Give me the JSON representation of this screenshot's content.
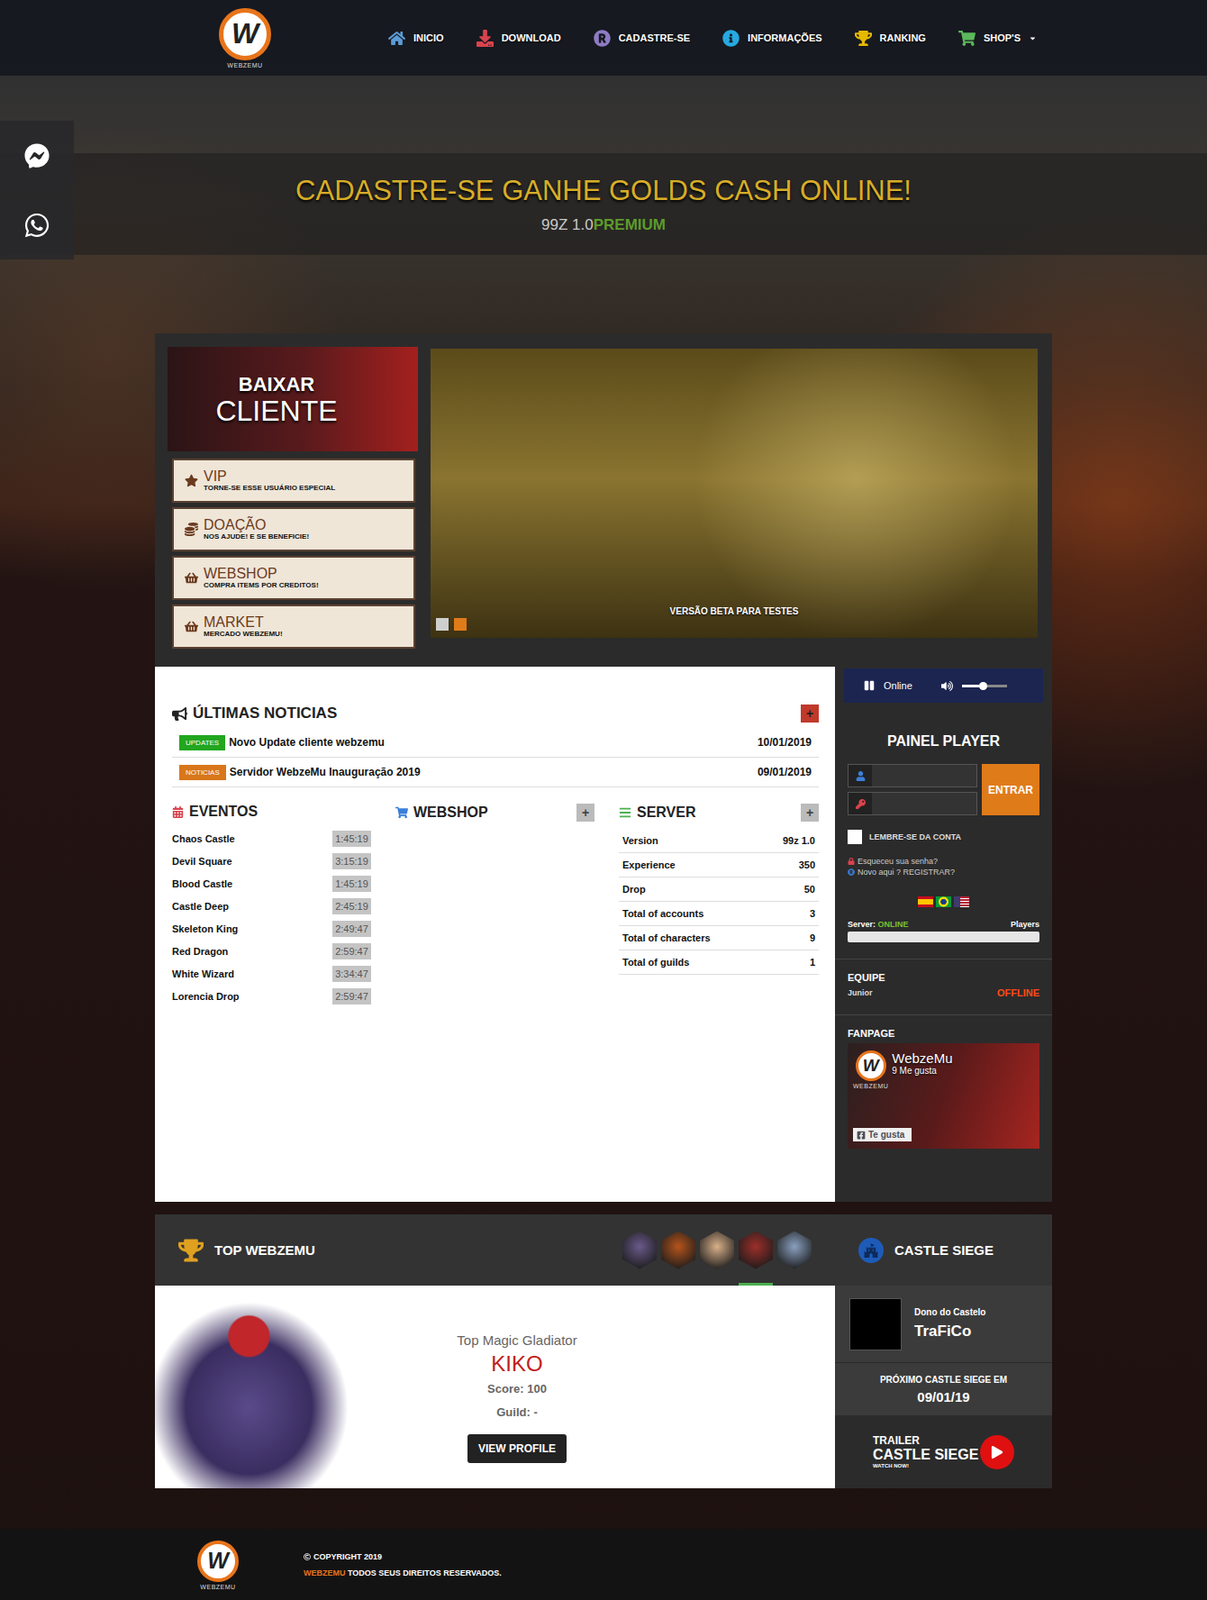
{
  "header": {
    "logo_letter": "W",
    "logo_caption": "WEBZEMU",
    "nav": [
      {
        "label": "INICIO",
        "dropdown": false
      },
      {
        "label": "DOWNLOAD",
        "dropdown": false
      },
      {
        "label": "CADASTRE-SE",
        "dropdown": false
      },
      {
        "label": "INFORMAÇÕES",
        "dropdown": false
      },
      {
        "label": "RANKING",
        "dropdown": false
      },
      {
        "label": "SHOP'S",
        "dropdown": true
      }
    ]
  },
  "hero": {
    "title": "CADASTRE-SE GANHE GOLDS CASH ONLINE!",
    "version": "99Z 1.0",
    "edition": "PREMIUM"
  },
  "download_banner": {
    "line1": "BAIXAR",
    "line2": "CLIENTE"
  },
  "side_buttons": [
    {
      "title": "VIP",
      "subtitle": "TORNE-SE ESSE USUÁRIO ESPECIAL"
    },
    {
      "title": "DOAÇÃO",
      "subtitle": "NOS AJUDE! E SE BENEFICIE!"
    },
    {
      "title": "WEBSHOP",
      "subtitle": "COMPRA ITEMS POR CREDITOS!"
    },
    {
      "title": "MARKET",
      "subtitle": "MERCADO WEBZEMU!"
    }
  ],
  "slider": {
    "caption": "VERSÃO BETA PARA TESTES",
    "dots": [
      {
        "selected": false
      },
      {
        "selected": true
      }
    ]
  },
  "news": {
    "title": "ÚLTIMAS NOTICIAS",
    "more": "+",
    "items": [
      {
        "tag": "UPDATES",
        "color": "#22a61f",
        "title": "Novo Update cliente webzemu",
        "date": "10/01/2019"
      },
      {
        "tag": "NOTICIAS",
        "color": "#d8761b",
        "title": "Servidor WebzeMu Inauguração 2019",
        "date": "09/01/2019"
      }
    ]
  },
  "events": {
    "title": "EVENTOS",
    "items": [
      {
        "name": "Chaos Castle",
        "time": "1:45:19"
      },
      {
        "name": "Devil Square",
        "time": "3:15:19"
      },
      {
        "name": "Blood Castle",
        "time": "1:45:19"
      },
      {
        "name": "Castle Deep",
        "time": "2:45:19"
      },
      {
        "name": "Skeleton King",
        "time": "2:49:47"
      },
      {
        "name": "Red Dragon",
        "time": "2:59:47"
      },
      {
        "name": "White Wizard",
        "time": "3:34:47"
      },
      {
        "name": "Lorencia Drop",
        "time": "2:59:47"
      }
    ]
  },
  "webshop": {
    "title": "WEBSHOP",
    "more": "+"
  },
  "server": {
    "title": "SERVER",
    "more": "+",
    "rows": [
      {
        "label": "Version",
        "value": "99z 1.0"
      },
      {
        "label": "Experience",
        "value": "350"
      },
      {
        "label": "Drop",
        "value": "50"
      },
      {
        "label": "Total of accounts",
        "value": "3"
      },
      {
        "label": "Total of characters",
        "value": "9"
      },
      {
        "label": "Total of guilds",
        "value": "1"
      }
    ]
  },
  "player": {
    "status": "Online",
    "playing": true,
    "volume": 0.47
  },
  "login": {
    "title": "PAINEL PLAYER",
    "username": "",
    "password": "",
    "button": "ENTRAR",
    "remember": {
      "label": "LEMBRE-SE DA CONTA",
      "checked": false
    },
    "forgot": "Esqueceu sua senha?",
    "register": "Novo aqui ? REGISTRAR?"
  },
  "server_status": {
    "label": "Server:",
    "status": "ONLINE",
    "players_label": "Players",
    "level": 0
  },
  "team": {
    "title": "EQUIPE",
    "members": [
      {
        "name": "Junior",
        "status": "OFFLINE"
      }
    ]
  },
  "fanpage": {
    "title": "FANPAGE",
    "page": "WebzeMu",
    "likes": "9 Me gusta",
    "button": "Te gusta",
    "logo_caption": "WEBZEMU"
  },
  "top": {
    "title": "TOP WEBZEMU",
    "classes": [
      {
        "color": "#6a5a8a",
        "selected": false
      },
      {
        "color": "#b5541c",
        "selected": false
      },
      {
        "color": "#d9b08a",
        "selected": false
      },
      {
        "color": "#9c2f2a",
        "selected": true
      },
      {
        "color": "#8aa0c0",
        "selected": false
      }
    ],
    "label": "Top Magic Gladiator",
    "name": "KIKO",
    "score": "Score: 100",
    "guild": "Guild: -",
    "button": "VIEW PROFILE"
  },
  "castle": {
    "title": "CASTLE SIEGE",
    "owner_label": "Dono do Castelo",
    "owner": "TraFiCo",
    "next_label": "PRÓXIMO CASTLE SIEGE EM",
    "next_date": "09/01/19",
    "trailer_line1": "TRAILER",
    "trailer_line2": "CASTLE SIEGE",
    "trailer_line3": "WATCH NOW!"
  },
  "footer": {
    "copyright": "COPYRIGHT 2019",
    "brand": "WEBZEMU",
    "rights": " TODOS SEUS DIREITOS RESERVADOS."
  }
}
